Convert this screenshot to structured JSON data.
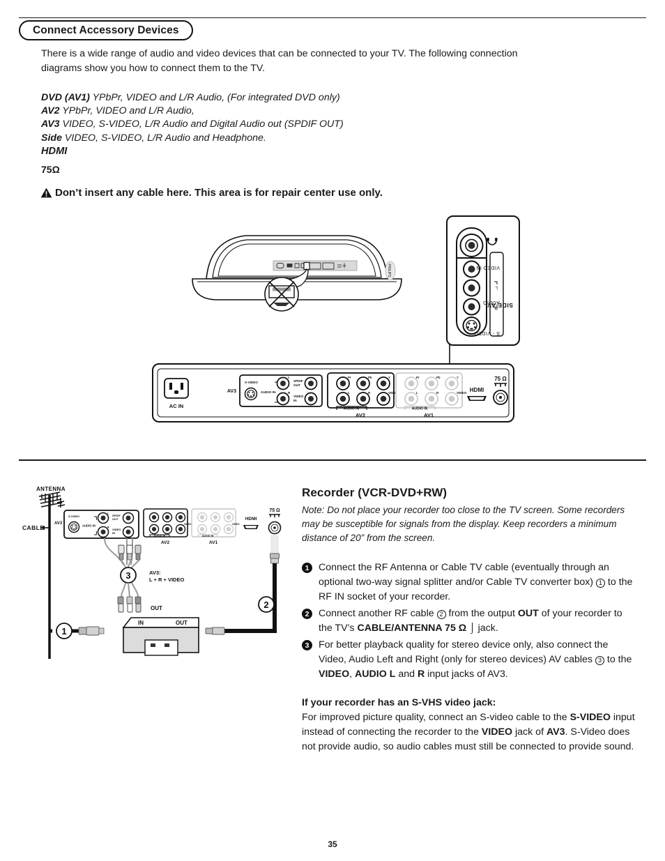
{
  "header": {
    "title": "Connect Accessory Devices"
  },
  "intro": {
    "text": "There is a wide range of audio and video devices that can be connected to your TV. The following connection diagrams show you how to connect them to the TV."
  },
  "specs": [
    {
      "term": "DVD (AV1)",
      "desc": "YPbPr, VIDEO and L/R Audio, (For integrated DVD only)"
    },
    {
      "term": "AV2",
      "desc": "YPbPr, VIDEO and L/R Audio,"
    },
    {
      "term": "AV3",
      "desc": "VIDEO, S-VIDEO, L/R Audio and Digital Audio out (SPDIF OUT)"
    },
    {
      "term": "Side",
      "desc": "VIDEO, S-VIDEO, L/R Audio and Headphone."
    }
  ],
  "spec_hdmi": "HDMI",
  "spec_ohm": "75Ω",
  "warning": {
    "icon": "warning-triangle-icon",
    "text": "Don’t insert any cable here. This area is for  repair center use only."
  },
  "top_figure": {
    "name": "tv-rear-and-side-panel-diagram",
    "side_panel": {
      "title": "SIDE AV",
      "headphone_icon": "headphone-icon",
      "labels": [
        "VIDEO IN",
        "AUDIO",
        "L",
        "R",
        "S - VIDEO"
      ]
    },
    "rear_panel": {
      "ac_in": "AC IN",
      "av3": {
        "label": "AV3",
        "svideo": "S-VIDEO",
        "audio_in": "AUDIO IN",
        "audio_l": "L",
        "audio_r": "R",
        "spdif_out": "SPDIF OUT",
        "video_in": "VIDEO IN"
      },
      "av2": {
        "label": "AV2",
        "top": [
          "Pr",
          "Pb",
          "Y"
        ],
        "bottom": [
          "L",
          "R",
          "VIDEO"
        ],
        "audio_in": "AUDIO IN"
      },
      "av1": {
        "label": "AV1",
        "top": [
          "Pr",
          "Pb",
          "Y"
        ],
        "bottom": [
          "L",
          "R",
          "VIDEO"
        ],
        "audio_in": "AUDIO IN"
      },
      "hdmi": "HDMI",
      "ohm": "75 Ω"
    }
  },
  "bottom_figure": {
    "name": "recorder-connection-diagram",
    "antenna_label": "ANTENNA",
    "cable_label": "CABLE",
    "av3_label": "AV3",
    "av3_cable_label_line1": "AV3:",
    "av3_cable_label_line2": "L + R + VIDEO",
    "out_label": "OUT",
    "recorder_in": "IN",
    "recorder_out": "OUT",
    "callouts": [
      "1",
      "2",
      "3"
    ],
    "panel": {
      "svideo": "S-VIDEO",
      "audio_in": "AUDIO IN",
      "audio_l": "L",
      "audio_r": "R",
      "spdif_out": "SPDIF OUT",
      "video_in": "VIDEO IN",
      "av2": "AV2",
      "av1": "AV1",
      "hdmi": "HDMI",
      "ohm": "75 Ω"
    }
  },
  "recorder": {
    "heading": "Recorder (VCR-DVD+RW)",
    "note": "Note: Do not place your recorder too close to the TV screen. Some recorders may be susceptible for signals from the display. Keep recorders a minimum distance of 20” from the screen.",
    "steps": [
      {
        "num": "1",
        "pre": "Connect the RF Antenna or Cable TV cable (eventually through an optional two-way signal splitter and/or Cable TV converter box) ",
        "circ": "1",
        "post": " to the RF IN socket of your recorder."
      },
      {
        "num": "2",
        "pre": "Connect another RF cable ",
        "circ": "2",
        "mid": " from the output ",
        "b1": "OUT",
        "mid2": " of your recorder to the TV’s ",
        "b2": "CABLE/ANTENNA 75 Ω",
        "post": " jack."
      },
      {
        "num": "3",
        "pre": "For better playback quality for stereo device only, also connect the Video, Audio Left and Right (only for stereo devices) AV cables ",
        "circ": "3",
        "mid": " to the ",
        "b1": "VIDEO",
        "mid2": ", ",
        "b2": "AUDIO L",
        "mid3": " and ",
        "b3": "R",
        "post": " input jacks of AV3."
      }
    ],
    "svhs": {
      "title_a": "If your recorder has an ",
      "title_b": "S-VHS",
      "title_c": " video jack:",
      "p1": "For improved picture quality, connect an S-video cable to the ",
      "b1": "S-VIDEO",
      "p2": " input instead of connecting the recorder to the ",
      "b2": "VIDEO",
      "p3": " jack of ",
      "b3": "AV3",
      "p4": ". S-Video does not provide audio, so audio cables must still be connected to provide sound."
    }
  },
  "page_number": "35"
}
